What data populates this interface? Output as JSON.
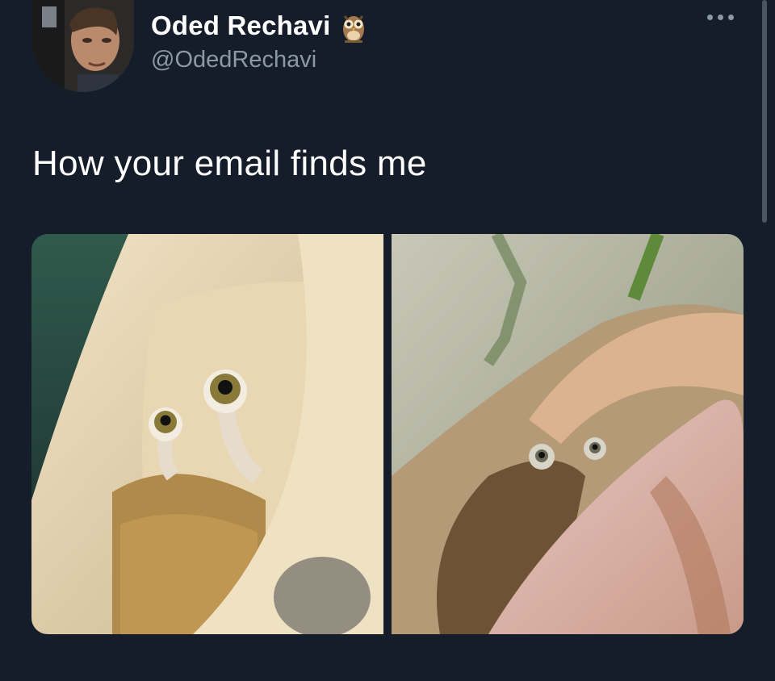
{
  "author": {
    "display_name": "Oded Rechavi",
    "handle": "@OdedRechavi",
    "name_emoji_icon": "owl-icon",
    "avatar_icon": "avatar-photo"
  },
  "tweet": {
    "text": "How your email finds me"
  },
  "menu": {
    "icon": "more-options-icon"
  },
  "media": {
    "images": [
      {
        "icon": "snail-in-shell-photo-1"
      },
      {
        "icon": "snail-in-shell-photo-2"
      }
    ]
  },
  "colors": {
    "background": "#151d2a",
    "primary_text": "#ffffff",
    "secondary_text": "#8b98a5"
  }
}
